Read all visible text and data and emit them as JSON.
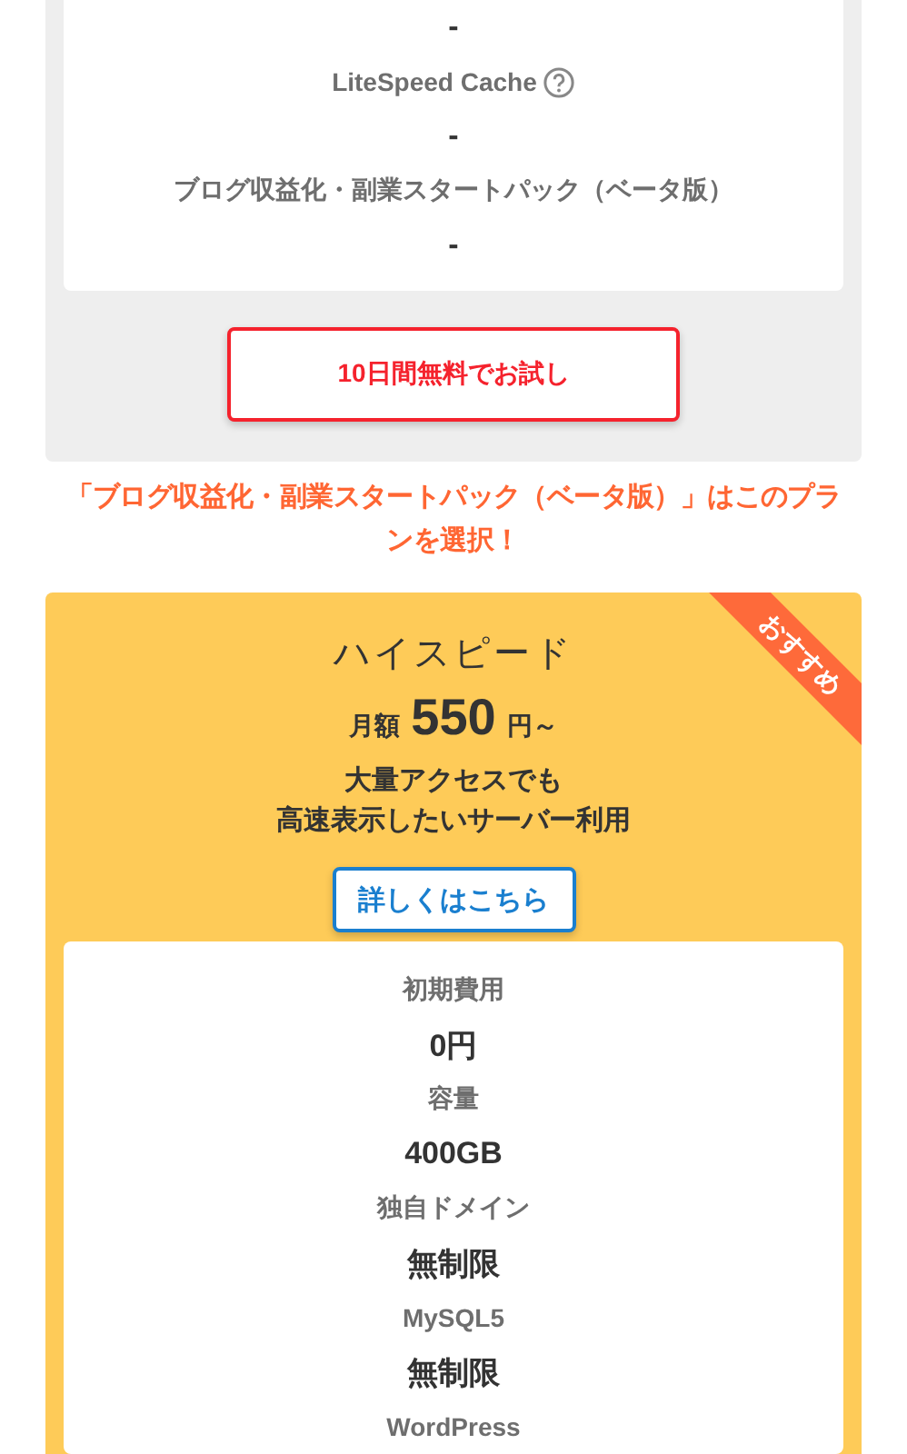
{
  "top_plan": {
    "features": [
      {
        "kind": "value",
        "text": "-"
      },
      {
        "kind": "label",
        "text": "LiteSpeed Cache",
        "help": true
      },
      {
        "kind": "value",
        "text": "-"
      },
      {
        "kind": "label",
        "text": "ブログ収益化・副業スタートパック（ベータ版）",
        "help": false
      },
      {
        "kind": "value",
        "text": "-"
      }
    ],
    "trial_button": "10日間無料でお試し"
  },
  "note": "「ブログ収益化・副業スタートパック（ベータ版）」はこのプランを選択！",
  "plan": {
    "ribbon": "おすすめ",
    "name": "ハイスピード",
    "price_prefix": "月額",
    "price": "550",
    "price_suffix": "円～",
    "description": [
      "大量アクセスでも",
      "高速表示したいサーバー利用"
    ],
    "details_button": "詳しくはこちら",
    "features": [
      {
        "kind": "label",
        "text": "初期費用",
        "help": false
      },
      {
        "kind": "value",
        "text": "0円"
      },
      {
        "kind": "label",
        "text": "容量",
        "help": false
      },
      {
        "kind": "value",
        "text": "400GB"
      },
      {
        "kind": "label",
        "text": "独自ドメイン",
        "help": false
      },
      {
        "kind": "value",
        "text": "無制限"
      },
      {
        "kind": "label",
        "text": "MySQL5",
        "help": false
      },
      {
        "kind": "value",
        "text": "無制限"
      },
      {
        "kind": "label",
        "text": "WordPress",
        "help": false
      }
    ]
  }
}
